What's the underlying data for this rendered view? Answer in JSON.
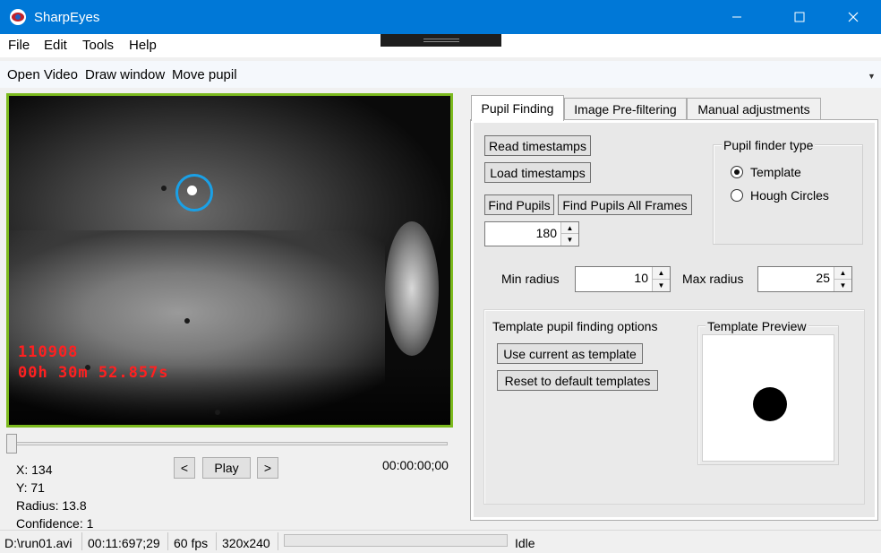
{
  "window": {
    "title": "SharpEyes",
    "min_icon": "minimize-icon",
    "max_icon": "maximize-icon",
    "close_icon": "close-icon"
  },
  "menu": {
    "file": "File",
    "edit": "Edit",
    "tools": "Tools",
    "help": "Help"
  },
  "toolbar": {
    "open_video": "Open Video",
    "draw_window": "Draw window",
    "move_pupil": "Move pupil"
  },
  "video": {
    "overlay_frame": "110908",
    "overlay_time": "00h 30m 52.857s",
    "border_color": "#7cba1e",
    "marker_color": "#1aa0e6"
  },
  "playback": {
    "prev": "<",
    "play": "Play",
    "next": ">",
    "timecode": "00:00:00;00",
    "position": 0
  },
  "pupil_info": {
    "x": "X: 134",
    "y": "Y: 71",
    "radius": "Radius: 13.8",
    "confidence": "Confidence: 1"
  },
  "tabs": [
    {
      "label": "Pupil Finding",
      "active": true
    },
    {
      "label": "Image Pre-filtering",
      "active": false
    },
    {
      "label": "Manual adjustments",
      "active": false
    }
  ],
  "pupil_finding": {
    "read_timestamps": "Read timestamps",
    "load_timestamps": "Load timestamps",
    "find_pupils": "Find Pupils",
    "find_pupils_all": "Find Pupils All Frames",
    "frames_value": "180",
    "finder_type": {
      "title": "Pupil finder type",
      "options": [
        {
          "label": "Template",
          "selected": true
        },
        {
          "label": "Hough Circles",
          "selected": false
        }
      ]
    },
    "min_radius_label": "Min radius",
    "min_radius_value": "10",
    "max_radius_label": "Max radius",
    "max_radius_value": "25",
    "template_options": {
      "title": "Template pupil finding options",
      "use_current": "Use current as template",
      "reset": "Reset to default templates",
      "preview_title": "Template Preview"
    }
  },
  "status": {
    "file": "D:\\run01.avi",
    "time": "00:11:697;29",
    "fps": "60 fps",
    "resolution": "320x240",
    "progress": 0,
    "state": "Idle"
  }
}
